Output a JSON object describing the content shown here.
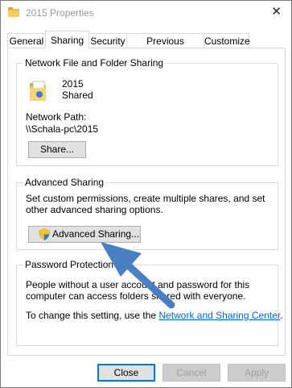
{
  "window": {
    "title": "2015 Properties",
    "close_glyph": "✕"
  },
  "tabs": [
    {
      "label": "General"
    },
    {
      "label": "Sharing"
    },
    {
      "label": "Security"
    },
    {
      "label": "Previous Versions"
    },
    {
      "label": "Customize"
    }
  ],
  "network_sharing": {
    "group_label": "Network File and Folder Sharing",
    "folder_name": "2015",
    "folder_status": "Shared",
    "path_label": "Network Path:",
    "path_value": "\\\\Schala-pc\\2015",
    "share_button": "Share..."
  },
  "advanced_sharing": {
    "group_label": "Advanced Sharing",
    "description": "Set custom permissions, create multiple shares, and set other advanced sharing options.",
    "button": "Advanced Sharing..."
  },
  "password_protection": {
    "group_label": "Password Protection",
    "description": "People without a user account and password for this computer can access folders shared with everyone.",
    "change_text": "To change this setting, use the",
    "link_text": "Network and Sharing Center",
    "period": "."
  },
  "footer": {
    "close": "Close",
    "cancel": "Cancel",
    "apply": "Apply"
  },
  "icons": [
    "folder-icon",
    "shared-folder-icon",
    "shield-icon",
    "arrow-annotation"
  ],
  "colors": {
    "link": "#0066cc",
    "arrow": "#4a7fc4",
    "default_border": "#0078d7"
  }
}
